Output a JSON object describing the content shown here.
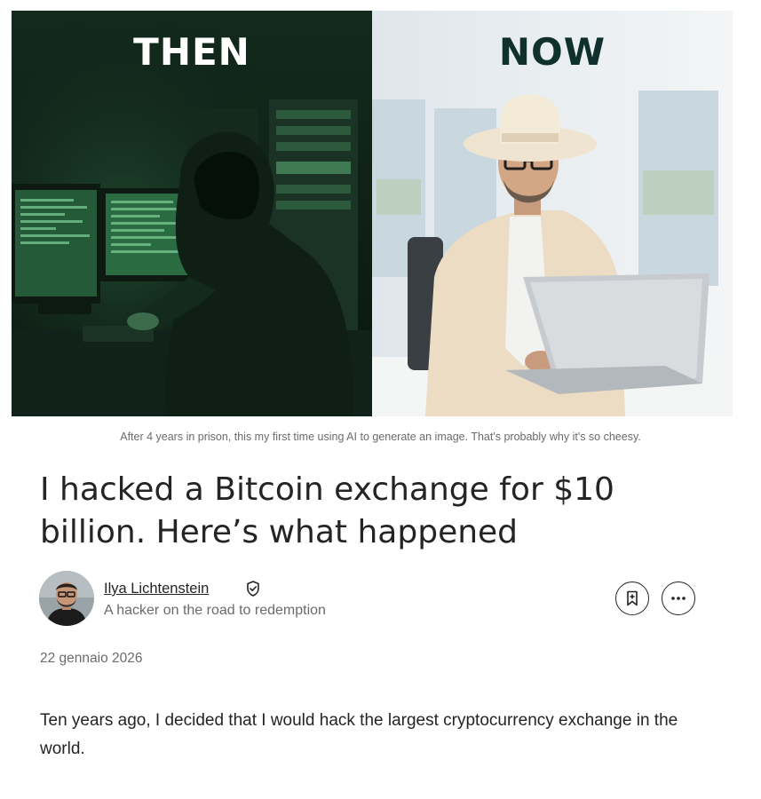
{
  "hero": {
    "left_label": "THEN",
    "right_label": "NOW"
  },
  "caption": "After 4 years in prison, this my first time using AI to generate an image. That's probably why it's so cheesy.",
  "article": {
    "title": "I hacked a Bitcoin exchange for $10 billion. Here’s what happened",
    "date": "22 gennaio 2026",
    "body": "Ten years ago, I decided that I would hack the largest cryptocurrency exchange in the world."
  },
  "author": {
    "name": "Ilya Lichtenstein",
    "bio": "A hacker on the road to redemption",
    "verified_icon": "verified-shield-icon"
  },
  "actions": {
    "save_icon": "bookmark-plus-icon",
    "more_icon": "more-horizontal-icon"
  },
  "colors": {
    "text_primary": "#242424",
    "text_secondary": "#6b6b6b",
    "then_bg": "#0e1f16",
    "now_label": "#10302e"
  }
}
